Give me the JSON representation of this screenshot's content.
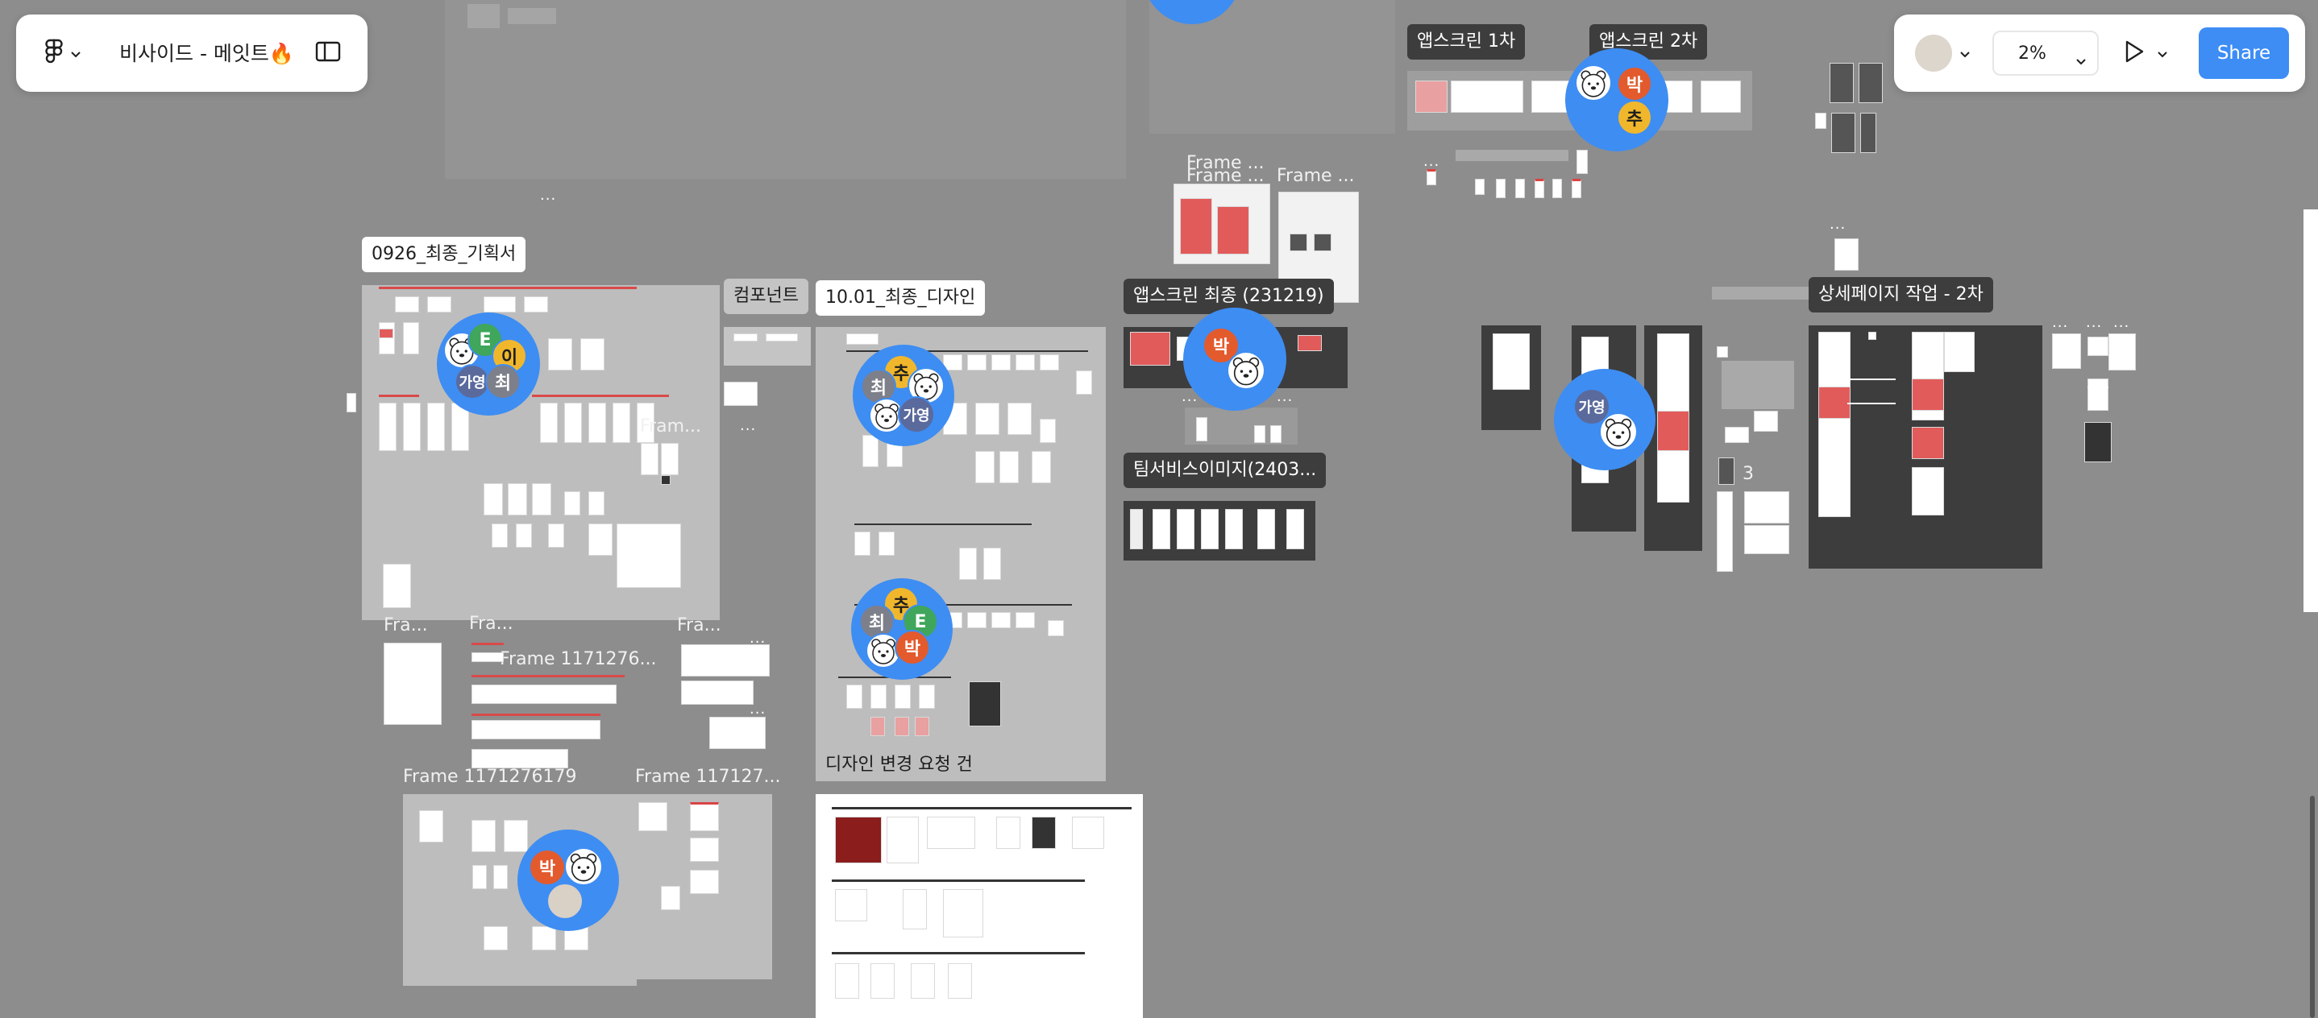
{
  "app": {
    "file_title": "비사이드 - 메잇트🔥",
    "zoom": "2%",
    "share_label": "Share"
  },
  "frames": {
    "f0926": "0926_최종_기획서",
    "components": "컴포넌트",
    "f1001": "10.01_최종_디자인",
    "design_change": "디자인 변경 요청 건",
    "appscreen_final": "앱스크린 최종 (231219)",
    "team_image": "팀서비스이미지(2403...",
    "appscreen1": "앱스크린 1차",
    "appscreen2": "앱스크린 2차",
    "detail_page": "상세페이지 작업 - 2차"
  },
  "ghost_labels": {
    "g1": "Frame ...",
    "g2": "Frame ...",
    "g3": "Frame ...",
    "g4": "Fram...",
    "g5": "Fra...",
    "g6": "Fra...",
    "g7": "Frame 1171276...",
    "g8": "Fra...",
    "g9": "Frame 1171276179",
    "g10": "Frame 117127...",
    "g11": "3"
  },
  "avatars": {
    "c1": [
      "E",
      "이",
      "가영",
      "최"
    ],
    "c2": [
      "추",
      "최",
      "가영"
    ],
    "c3": [
      "추",
      "최",
      "E",
      "박"
    ],
    "c4": [
      "박"
    ],
    "c5": [
      "박"
    ],
    "c6": [
      "가영"
    ],
    "c7": [
      "박",
      "추"
    ]
  },
  "icons": {
    "main_menu": "figma-logo-icon",
    "panel_toggle": "sidebar-toggle-icon",
    "play": "play-icon",
    "chevron": "chevron-down-icon"
  }
}
